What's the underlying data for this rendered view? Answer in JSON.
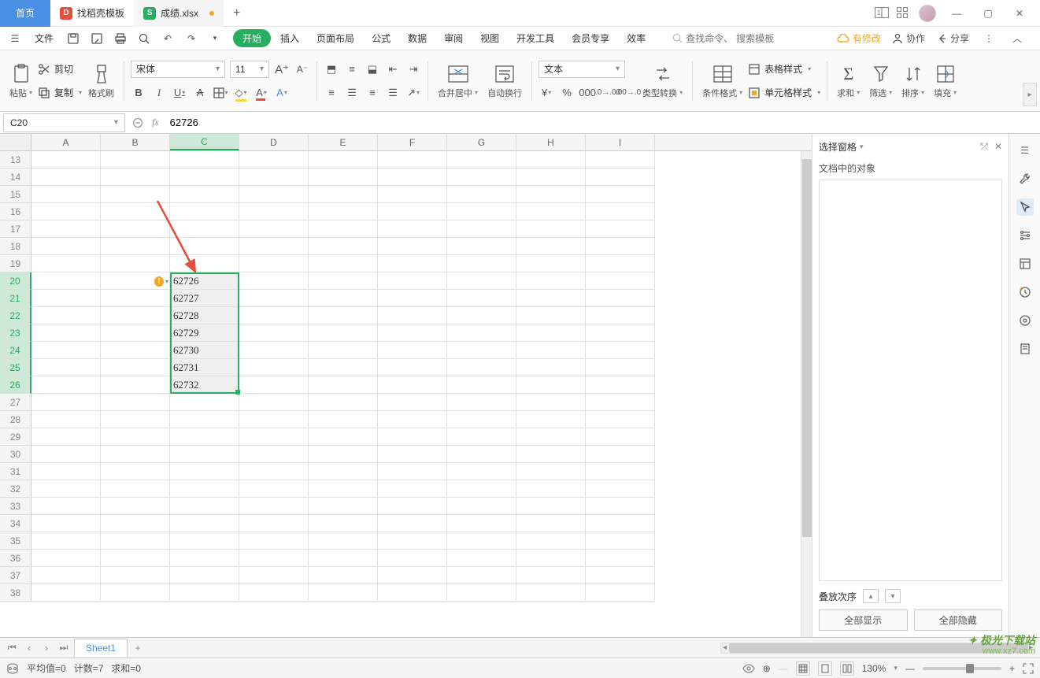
{
  "titlebar": {
    "home": "首页",
    "tab1": "找稻壳模板",
    "tab2": "成绩.xlsx"
  },
  "menubar": {
    "file": "文件",
    "tabs": {
      "start": "开始",
      "insert": "插入",
      "layout": "页面布局",
      "formula": "公式",
      "data": "数据",
      "review": "审阅",
      "view": "视图",
      "dev": "开发工具",
      "member": "会员专享",
      "efficiency": "效率"
    },
    "search1": "查找命令、",
    "search2": "搜索模板",
    "unsync": "有修改",
    "collab": "协作",
    "share": "分享"
  },
  "toolbar": {
    "paste": "粘贴",
    "cut": "剪切",
    "copy": "复制",
    "format_painter": "格式刷",
    "font_name": "宋体",
    "font_size": "11",
    "merge": "合并居中",
    "wrap": "自动换行",
    "number_format": "文本",
    "type_convert": "类型转换",
    "cond_fmt": "条件格式",
    "table_style": "表格样式",
    "cell_style": "单元格样式",
    "sum": "求和",
    "filter": "筛选",
    "sort": "排序",
    "fill": "填充"
  },
  "formulabar": {
    "cellref": "C20",
    "formula": "62726"
  },
  "grid": {
    "cols": [
      "A",
      "B",
      "C",
      "D",
      "E",
      "F",
      "G",
      "H",
      "I"
    ],
    "row_start": 13,
    "row_end": 38,
    "sel_col": "C",
    "sel_rows_start": 20,
    "sel_rows_end": 26,
    "data": {
      "20": "62726",
      "21": "62727",
      "22": "62728",
      "23": "62729",
      "24": "62730",
      "25": "62731",
      "26": "62732"
    }
  },
  "taskpane": {
    "title": "选择窗格",
    "subtitle": "文档中的对象",
    "order": "叠放次序",
    "show_all": "全部显示",
    "hide_all": "全部隐藏"
  },
  "sheetbar": {
    "sheet1": "Sheet1"
  },
  "statusbar": {
    "avg": "平均值=0",
    "count": "计数=7",
    "sum": "求和=0",
    "zoom": "130%"
  },
  "watermark": {
    "logo": "极光下载站",
    "url": "www.xz7.com"
  }
}
